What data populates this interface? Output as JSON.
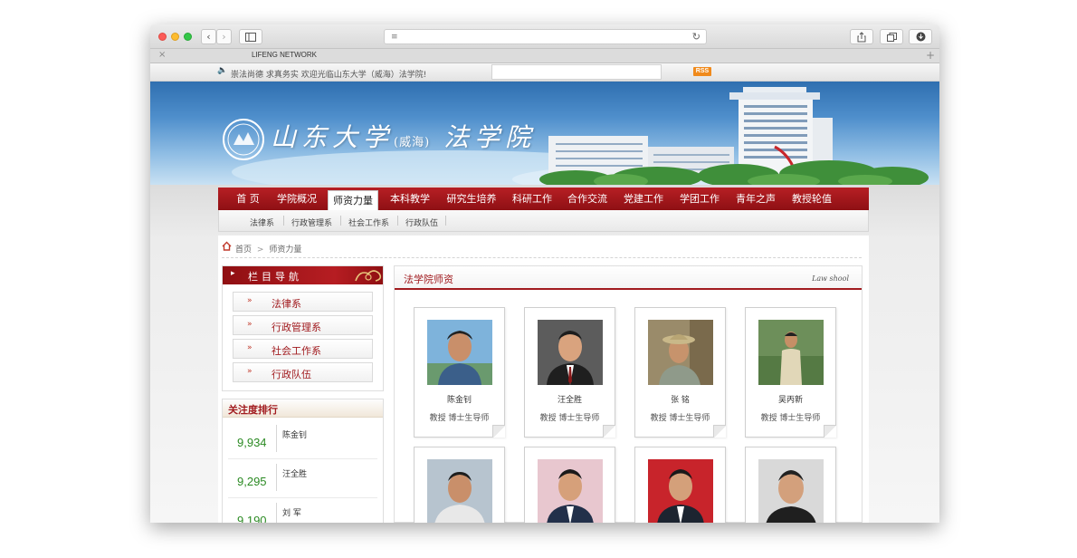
{
  "browser": {
    "tab_title": "LIFENG NETWORK",
    "close_glyph": "×",
    "plus_glyph": "+",
    "address_value": "",
    "icons": {
      "back": "chevron-left-icon",
      "forward": "chevron-right-icon",
      "sidebar": "sidebar-icon",
      "reader": "reader-lines-icon",
      "reload": "reload-icon",
      "share": "share-icon",
      "tabs": "tabs-icon",
      "download": "download-icon"
    }
  },
  "site": {
    "motto": "崇法尚德  求真务实  欢迎光临山东大学（威海）法学院!",
    "rss_label": "RSS",
    "logo_main": "山东大学",
    "logo_sub": "(威海)",
    "logo_college": "法学院",
    "colors": {
      "brand_red": "#a11b1f",
      "nav_red": "#b71f24",
      "rank_green": "#2b8a23",
      "banner_blue": "#2f6fb0"
    }
  },
  "nav": {
    "items": [
      "首  页",
      "学院概况",
      "师资力量",
      "本科教学",
      "研究生培养",
      "科研工作",
      "合作交流",
      "党建工作",
      "学团工作",
      "青年之声",
      "教授轮值"
    ],
    "active_index": 2
  },
  "subnav": {
    "items": [
      "法律系",
      "行政管理系",
      "社会工作系",
      "行政队伍"
    ]
  },
  "breadcrumb": {
    "home": "首页",
    "separator": ">",
    "current": "师资力量"
  },
  "sidebar": {
    "title": "栏目导航",
    "arrow": "▸",
    "chevron": "»",
    "items": [
      "法律系",
      "行政管理系",
      "社会工作系",
      "行政队伍"
    ]
  },
  "ranking": {
    "title": "关注度排行",
    "rows": [
      {
        "count": "9,934",
        "name": "陈金钊"
      },
      {
        "count": "9,295",
        "name": "汪全胜"
      },
      {
        "count": "9,190",
        "name": "刘  军"
      }
    ]
  },
  "faculty": {
    "title": "法学院师资",
    "title_en": "Law shool",
    "members": [
      {
        "name": "陈金钊",
        "title": "教授  博士生导师"
      },
      {
        "name": "汪全胜",
        "title": "教授  博士生导师"
      },
      {
        "name": "张  铭",
        "title": "教授  博士生导师"
      },
      {
        "name": "吴丙新",
        "title": "教授  博士生导师"
      },
      {
        "name": "",
        "title": ""
      },
      {
        "name": "",
        "title": ""
      },
      {
        "name": "",
        "title": ""
      },
      {
        "name": "",
        "title": ""
      }
    ]
  }
}
